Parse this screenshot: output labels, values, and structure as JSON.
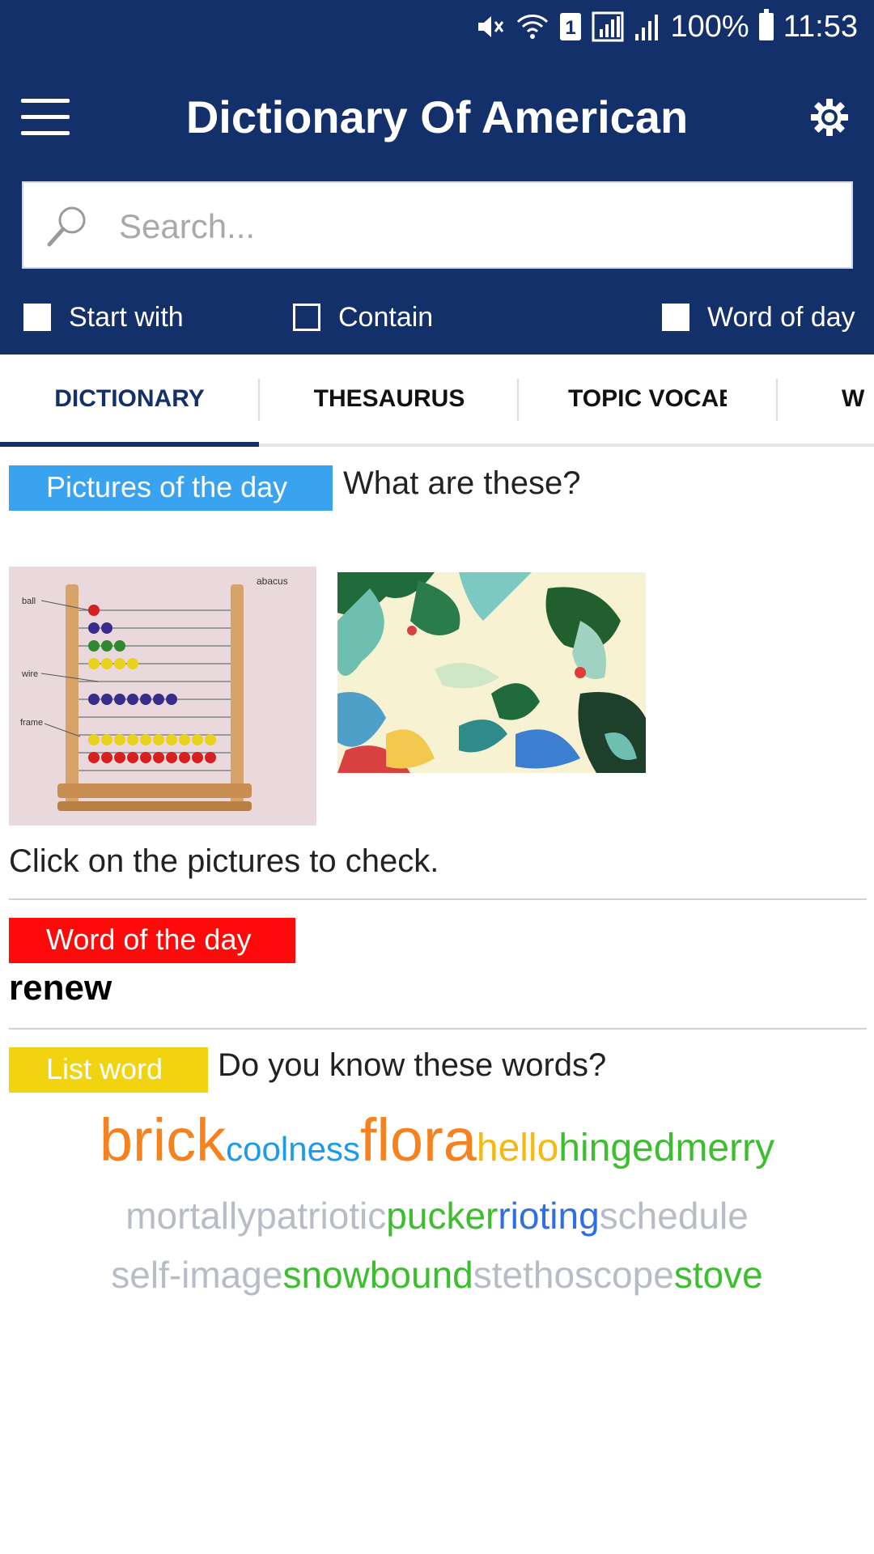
{
  "status_bar": {
    "battery": "100%",
    "time": "11:53",
    "icons": [
      "mute-icon",
      "wifi-icon",
      "sim-1-icon",
      "signal-icon",
      "signal-icon",
      "battery-icon"
    ]
  },
  "toolbar": {
    "title": "Dictionary Of American",
    "menu_icon": "hamburger-menu-icon",
    "settings_icon": "gear-icon"
  },
  "search": {
    "placeholder": "Search...",
    "value": ""
  },
  "filters": [
    {
      "label": "Start with",
      "checked": false
    },
    {
      "label": "Contain",
      "checked": false
    },
    {
      "label": "Word of day",
      "checked": false
    }
  ],
  "tabs": [
    {
      "label": "DICTIONARY",
      "active": true
    },
    {
      "label": "THESAURUS",
      "active": false
    },
    {
      "label": "TOPIC VOCAB",
      "active": false
    },
    {
      "label": "W",
      "active": false
    }
  ],
  "pictures_section": {
    "badge": "Pictures of the day",
    "question": "What are these?",
    "abacus_labels": {
      "title": "abacus",
      "ball": "ball",
      "wire": "wire",
      "frame": "frame"
    },
    "caption": "Click on the pictures to check."
  },
  "word_of_day": {
    "badge": "Word of the day",
    "word": "renew"
  },
  "list_word": {
    "badge": "List word",
    "question": "Do you know these words?",
    "lines": [
      [
        {
          "text": "brick",
          "color": "#f5821f",
          "size": 74
        },
        {
          "text": "coolness",
          "color": "#1e9be8",
          "size": 42
        },
        {
          "text": "flora",
          "color": "#f5821f",
          "size": 74
        },
        {
          "text": "hello",
          "color": "#f5b80f",
          "size": 48
        },
        {
          "text": "hingedmerry",
          "color": "#3cbf2e",
          "size": 48
        }
      ],
      [
        {
          "text": "mortallypatriotic",
          "color": "#b8bcc6",
          "size": 46
        },
        {
          "text": "pucker",
          "color": "#3cbf2e",
          "size": 46
        },
        {
          "text": "rioting",
          "color": "#2f6fe6",
          "size": 46
        },
        {
          "text": "schedule",
          "color": "#b8bcc6",
          "size": 46
        }
      ],
      [
        {
          "text": "self-image",
          "color": "#b8bcc6",
          "size": 46
        },
        {
          "text": "snowbound",
          "color": "#3cbf2e",
          "size": 46
        },
        {
          "text": "stethoscope",
          "color": "#b8bcc6",
          "size": 46
        },
        {
          "text": "stove",
          "color": "#3cbf2e",
          "size": 46
        }
      ]
    ]
  },
  "colors": {
    "header": "#13306b",
    "pictures_badge": "#3aa3f0",
    "word_badge": "#ff0a0a",
    "list_badge": "#f2d30f"
  }
}
